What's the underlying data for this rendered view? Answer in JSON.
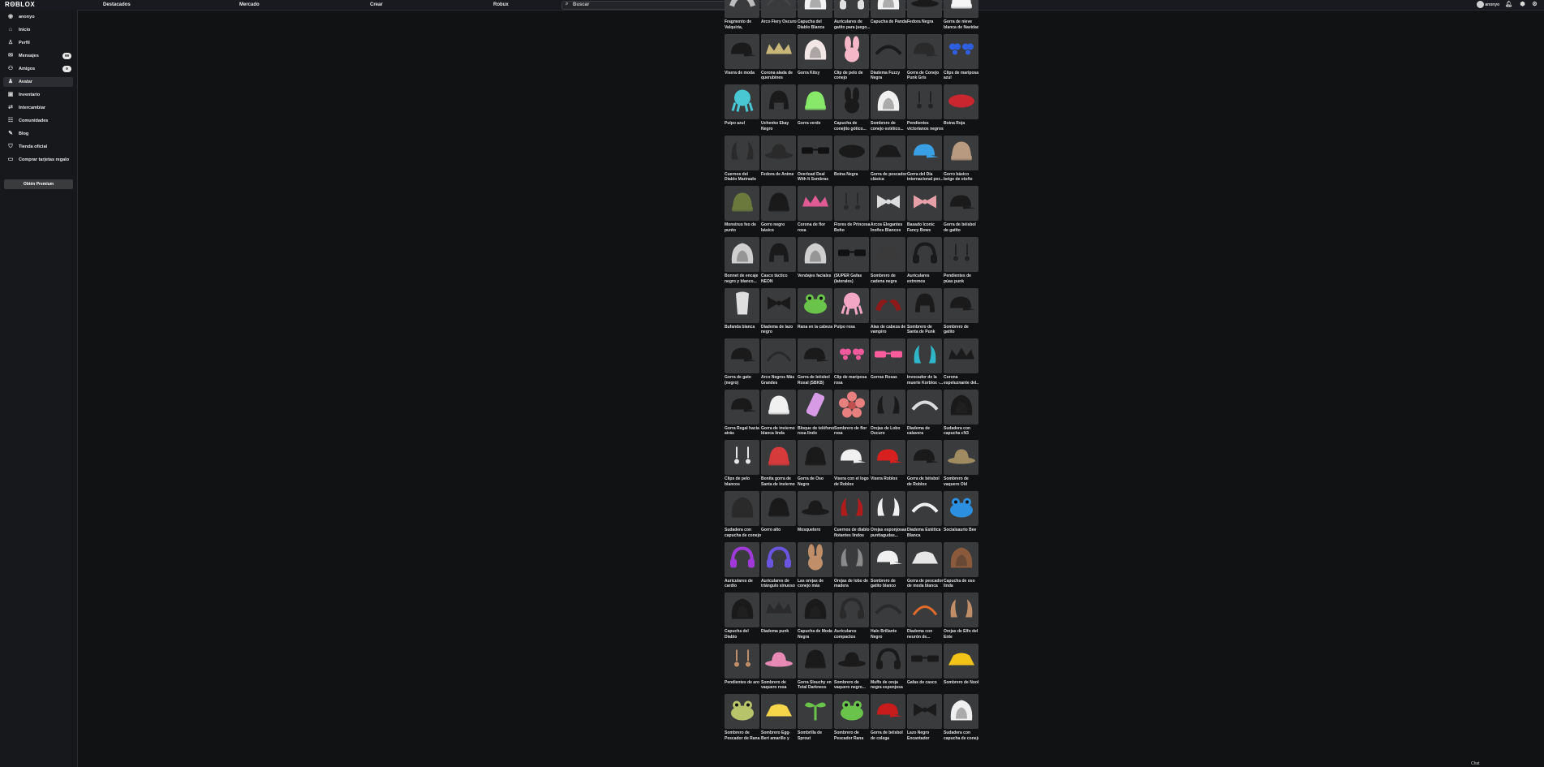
{
  "header": {
    "logo": "RΘBLOX",
    "nav": [
      "Destacados",
      "Mercado",
      "Crear",
      "Robux"
    ],
    "search_placeholder": "Buscar",
    "username": "anonyo"
  },
  "sidebar": {
    "username": "anonyo",
    "items": [
      {
        "label": "Inicio",
        "icon": "home-icon"
      },
      {
        "label": "Perfil",
        "icon": "profile-icon"
      },
      {
        "label": "Mensajes",
        "icon": "messages-icon",
        "badge": "99"
      },
      {
        "label": "Amigos",
        "icon": "friends-icon",
        "badge": "9"
      },
      {
        "label": "Avatar",
        "icon": "avatar-icon",
        "active": true
      },
      {
        "label": "Inventario",
        "icon": "inventory-icon"
      },
      {
        "label": "Intercambiar",
        "icon": "trade-icon"
      },
      {
        "label": "Comunidades",
        "icon": "communities-icon"
      },
      {
        "label": "Blog",
        "icon": "blog-icon"
      },
      {
        "label": "Tienda oficial",
        "icon": "shop-icon"
      },
      {
        "label": "Comprar tarjetas regalo",
        "icon": "gift-card-icon"
      }
    ],
    "premium_button": "Obtén Premium"
  },
  "catalog": {
    "items": [
      {
        "name": "Fragmento de Valquiria, jugador...",
        "color": "#bdbdbd",
        "shape": "wing"
      },
      {
        "name": "Arco Fiery Oscuro",
        "color": "#444",
        "shape": "arc"
      },
      {
        "name": "Capucha del Diablo Blanca",
        "color": "#f2f2f2",
        "shape": "hood"
      },
      {
        "name": "Auriculares de gatito para juego...",
        "color": "#e0e0e0",
        "shape": "headphones"
      },
      {
        "name": "Capucha de Panda",
        "color": "#f2f2f2",
        "shape": "hood"
      },
      {
        "name": "Fedora Negra",
        "color": "#1a1a1a",
        "shape": "hat"
      },
      {
        "name": "Gorra de nieve blanca de Navidad",
        "color": "#f5f5f5",
        "shape": "beanie"
      },
      {
        "name": "Visera de moda",
        "color": "#1a1a1a",
        "shape": "cap"
      },
      {
        "name": "Corona alada de querubines",
        "color": "#c9b77a",
        "shape": "crown"
      },
      {
        "name": "Gorra Kitsy",
        "color": "#f2e6e6",
        "shape": "hood"
      },
      {
        "name": "Clip de pelo de conejo",
        "color": "#f6b8c8",
        "shape": "bunny"
      },
      {
        "name": "Diadema Fuzzy Negra",
        "color": "#1a1a1a",
        "shape": "band"
      },
      {
        "name": "Gorra de Conejo Punk Gris",
        "color": "#2a2a2a",
        "shape": "cap"
      },
      {
        "name": "Clips de mariposa azul",
        "color": "#2f5fe0",
        "shape": "butterfly"
      },
      {
        "name": "Pulpo azul",
        "color": "#49c7d3",
        "shape": "octopus"
      },
      {
        "name": "Uchenko Ekay Negro",
        "color": "#1a1a1a",
        "shape": "helmet"
      },
      {
        "name": "Gorra verde",
        "color": "#88e86a",
        "shape": "beanie"
      },
      {
        "name": "Capucha de conejito gótico...",
        "color": "#1a1a1a",
        "shape": "bunny"
      },
      {
        "name": "Sombrero de conejo estético...",
        "color": "#f0f0f0",
        "shape": "hood"
      },
      {
        "name": "Pendientes victorianos negros",
        "color": "#222",
        "shape": "earring"
      },
      {
        "name": "Boina Roja",
        "color": "#c9262f",
        "shape": "beret"
      },
      {
        "name": "Cuernos del Diablo Marinado",
        "color": "#2a2a2a",
        "shape": "horns"
      },
      {
        "name": "Fedora de Anime",
        "color": "#2a2a2a",
        "shape": "hat"
      },
      {
        "name": "Overload Deal With It Sombras",
        "color": "#111",
        "shape": "glasses"
      },
      {
        "name": "Boina Negra",
        "color": "#1a1a1a",
        "shape": "beret"
      },
      {
        "name": "Gorra de pescador clásica",
        "color": "#1a1a1a",
        "shape": "bucket"
      },
      {
        "name": "Gorra del Día internacional por...",
        "color": "#3aa0e6",
        "shape": "cap"
      },
      {
        "name": "Gorro básico beige de otoño",
        "color": "#b89a80",
        "shape": "beanie"
      },
      {
        "name": "Monstruo feo de punto",
        "color": "#6b7a3c",
        "shape": "beanie"
      },
      {
        "name": "Gorro negro básico",
        "color": "#1a1a1a",
        "shape": "beanie"
      },
      {
        "name": "Corona de flor rosa",
        "color": "#e05a93",
        "shape": "crown"
      },
      {
        "name": "Flores de Princesa Boho",
        "color": "#2a2a2a",
        "shape": "earring"
      },
      {
        "name": "Arcos Elegantes Inoños Blancos",
        "color": "#dcdcdc",
        "shape": "bow"
      },
      {
        "name": "Basado Iconic Fancy Bows",
        "color": "#e6a0a8",
        "shape": "bow"
      },
      {
        "name": "Gorra de béisbol de gatito",
        "color": "#1a1a1a",
        "shape": "cap"
      },
      {
        "name": "Bonnet de encaje negro y blanco...",
        "color": "#cfcfcf",
        "shape": "hood"
      },
      {
        "name": "Casco táctico NEON",
        "color": "#1a1a1a",
        "shape": "helmet"
      },
      {
        "name": "Vendajes faciales",
        "color": "#cfcfcf",
        "shape": "hood"
      },
      {
        "name": "(SUPER Gafas (laterales)",
        "color": "#111",
        "shape": "glasses"
      },
      {
        "name": "Sombrero de cadena negra",
        "color": "#3a3a3a",
        "shape": "bucket"
      },
      {
        "name": "Auriculares extremos",
        "color": "#1a1a1a",
        "shape": "headphones"
      },
      {
        "name": "Pendientes de púas punk",
        "color": "#222",
        "shape": "earring"
      },
      {
        "name": "Bufanda blanca",
        "color": "#dedede",
        "shape": "scarf"
      },
      {
        "name": "Diadema de lazo negro",
        "color": "#1a1a1a",
        "shape": "bow"
      },
      {
        "name": "Rana en la cabeza",
        "color": "#6ac34a",
        "shape": "frog"
      },
      {
        "name": "Pulpo rosa",
        "color": "#f4a7c4",
        "shape": "octopus"
      },
      {
        "name": "Alas de cabeza de vampiro",
        "color": "#8c1a1a",
        "shape": "wing"
      },
      {
        "name": "Sombrero de Santa de Punk Rock de...",
        "color": "#1a1a1a",
        "shape": "helmet"
      },
      {
        "name": "Sombrero de gatito",
        "color": "#1a1a1a",
        "shape": "cap"
      },
      {
        "name": "Gorra de gato (negro)",
        "color": "#1a1a1a",
        "shape": "cap"
      },
      {
        "name": "Arco Negros Más Grandes",
        "color": "#2a2a2a",
        "shape": "arc"
      },
      {
        "name": "Gorra de béisbol Roxal (SBKB)",
        "color": "#1a1a1a",
        "shape": "cap"
      },
      {
        "name": "Clip de mariposa rosa",
        "color": "#f05a9c",
        "shape": "butterfly"
      },
      {
        "name": "Gorras Rosas",
        "color": "#ff5c9e",
        "shape": "glasses"
      },
      {
        "name": "Invocador de la muerte Korblox -...",
        "color": "#2fb7c9",
        "shape": "horns"
      },
      {
        "name": "Corona espeluznante del...",
        "color": "#1a1a1a",
        "shape": "crown"
      },
      {
        "name": "Gorra Regal hacia atrás",
        "color": "#1a1a1a",
        "shape": "cap"
      },
      {
        "name": "Gorra de invierno blanca linda",
        "color": "#f0f0f0",
        "shape": "beanie"
      },
      {
        "name": "Bloque de teléfono rosa lindo",
        "color": "#d79be6",
        "shape": "phone"
      },
      {
        "name": "Sombrero de flor rosa",
        "color": "#e88080",
        "shape": "flower"
      },
      {
        "name": "Orejas de Lobo Oscuro",
        "color": "#1a1a1a",
        "shape": "horns"
      },
      {
        "name": "Diadema de calavera",
        "color": "#dcdcdc",
        "shape": "band"
      },
      {
        "name": "Sudadera con capucha cN3",
        "color": "#1a1a1a",
        "shape": "hood"
      },
      {
        "name": "Clips de pelo blancos",
        "color": "#e6e6e6",
        "shape": "earring"
      },
      {
        "name": "Bonita gorra de Santa de invierno",
        "color": "#d63a3a",
        "shape": "beanie"
      },
      {
        "name": "Gorra de Oso Negro",
        "color": "#1a1a1a",
        "shape": "beanie"
      },
      {
        "name": "Visera con el logo de Roblox",
        "color": "#f0f0f0",
        "shape": "cap"
      },
      {
        "name": "Visera Roblox",
        "color": "#d92020",
        "shape": "cap"
      },
      {
        "name": "Gorra de béisbol de Roblox",
        "color": "#1a1a1a",
        "shape": "cap"
      },
      {
        "name": "Sombrero de vaquero Old Town...",
        "color": "#a08a62",
        "shape": "hat"
      },
      {
        "name": "Sudadera con capucha de conejo",
        "color": "#2a2a2a",
        "shape": "hood"
      },
      {
        "name": "Gorro alto",
        "color": "#1a1a1a",
        "shape": "beanie"
      },
      {
        "name": "Mosquetero",
        "color": "#1a1a1a",
        "shape": "hat"
      },
      {
        "name": "Cuernos de diablo flotantes lindos",
        "color": "#b01c1c",
        "shape": "horns"
      },
      {
        "name": "Orejas esponjosas puntiagudas...",
        "color": "#f0f0f0",
        "shape": "horns"
      },
      {
        "name": "Diadema Estética Blanca",
        "color": "#f0f0f0",
        "shape": "band"
      },
      {
        "name": "Socialsaurio Bee",
        "color": "#2d8fe0",
        "shape": "frog"
      },
      {
        "name": "Auriculares de cardio",
        "color": "#9f3ad9",
        "shape": "headphones"
      },
      {
        "name": "Auriculares de triángulo sinuoso",
        "color": "#6a55e0",
        "shape": "headphones"
      },
      {
        "name": "Las orejas de conejo más lindas...",
        "color": "#c08f6a",
        "shape": "bunny"
      },
      {
        "name": "Orejas de lobo de madera",
        "color": "#8a8a8a",
        "shape": "horns"
      },
      {
        "name": "Sombrero de gatito blanco",
        "color": "#f0f0f0",
        "shape": "cap"
      },
      {
        "name": "Gorra de pescador de moda blanca",
        "color": "#e6e6e6",
        "shape": "bucket"
      },
      {
        "name": "Capucha de oso linda",
        "color": "#8b5a3c",
        "shape": "hood"
      },
      {
        "name": "Capucha del Diablo",
        "color": "#1a1a1a",
        "shape": "hood"
      },
      {
        "name": "Diadema punk",
        "color": "#2a2a2a",
        "shape": "crown"
      },
      {
        "name": "Capucha de Moda Negra",
        "color": "#1a1a1a",
        "shape": "hood"
      },
      {
        "name": "Auriculares compactos",
        "color": "#2a2a2a",
        "shape": "headphones"
      },
      {
        "name": "Halo Brillante Negro",
        "color": "#2a2a2a",
        "shape": "band"
      },
      {
        "name": "Diadema con neurón de...",
        "color": "#e06a2a",
        "shape": "arc"
      },
      {
        "name": "Orejas de Elfo del Ente",
        "color": "#c08f6a",
        "shape": "horns"
      },
      {
        "name": "Pendientes de aro",
        "color": "#c08f6a",
        "shape": "earring"
      },
      {
        "name": "Sombrero de vaquero rosa",
        "color": "#e68ab4",
        "shape": "hat"
      },
      {
        "name": "Gorra Slouchy en Total Darkness",
        "color": "#1a1a1a",
        "shape": "beanie"
      },
      {
        "name": "Sombrero de vaquero negro...",
        "color": "#1a1a1a",
        "shape": "hat"
      },
      {
        "name": "Muffs de oreja negra esponjosa",
        "color": "#1a1a1a",
        "shape": "headphones"
      },
      {
        "name": "Gafas de casco",
        "color": "#1a1a1a",
        "shape": "glasses"
      },
      {
        "name": "Sombrero de Noob",
        "color": "#f2c418",
        "shape": "bucket"
      },
      {
        "name": "Sombrero de Pescador de Rana",
        "color": "#b8c46a",
        "shape": "frog"
      },
      {
        "name": "Sombrero Egg-Bert amarillo y negro",
        "color": "#f5d64a",
        "shape": "bucket"
      },
      {
        "name": "Sombrilla de Sprout",
        "color": "#6ac34a",
        "shape": "sprout"
      },
      {
        "name": "Sombrero de Pescador Rana",
        "color": "#6ac34a",
        "shape": "frog"
      },
      {
        "name": "Gorra de béisbol de colega",
        "color": "#c81c1c",
        "shape": "cap"
      },
      {
        "name": "Lazo Negro Encantador",
        "color": "#1a1a1a",
        "shape": "bow"
      },
      {
        "name": "Sudadera con capucha de conejo",
        "color": "#f0f0f0",
        "shape": "hood"
      }
    ]
  },
  "footer_text": "Chat"
}
